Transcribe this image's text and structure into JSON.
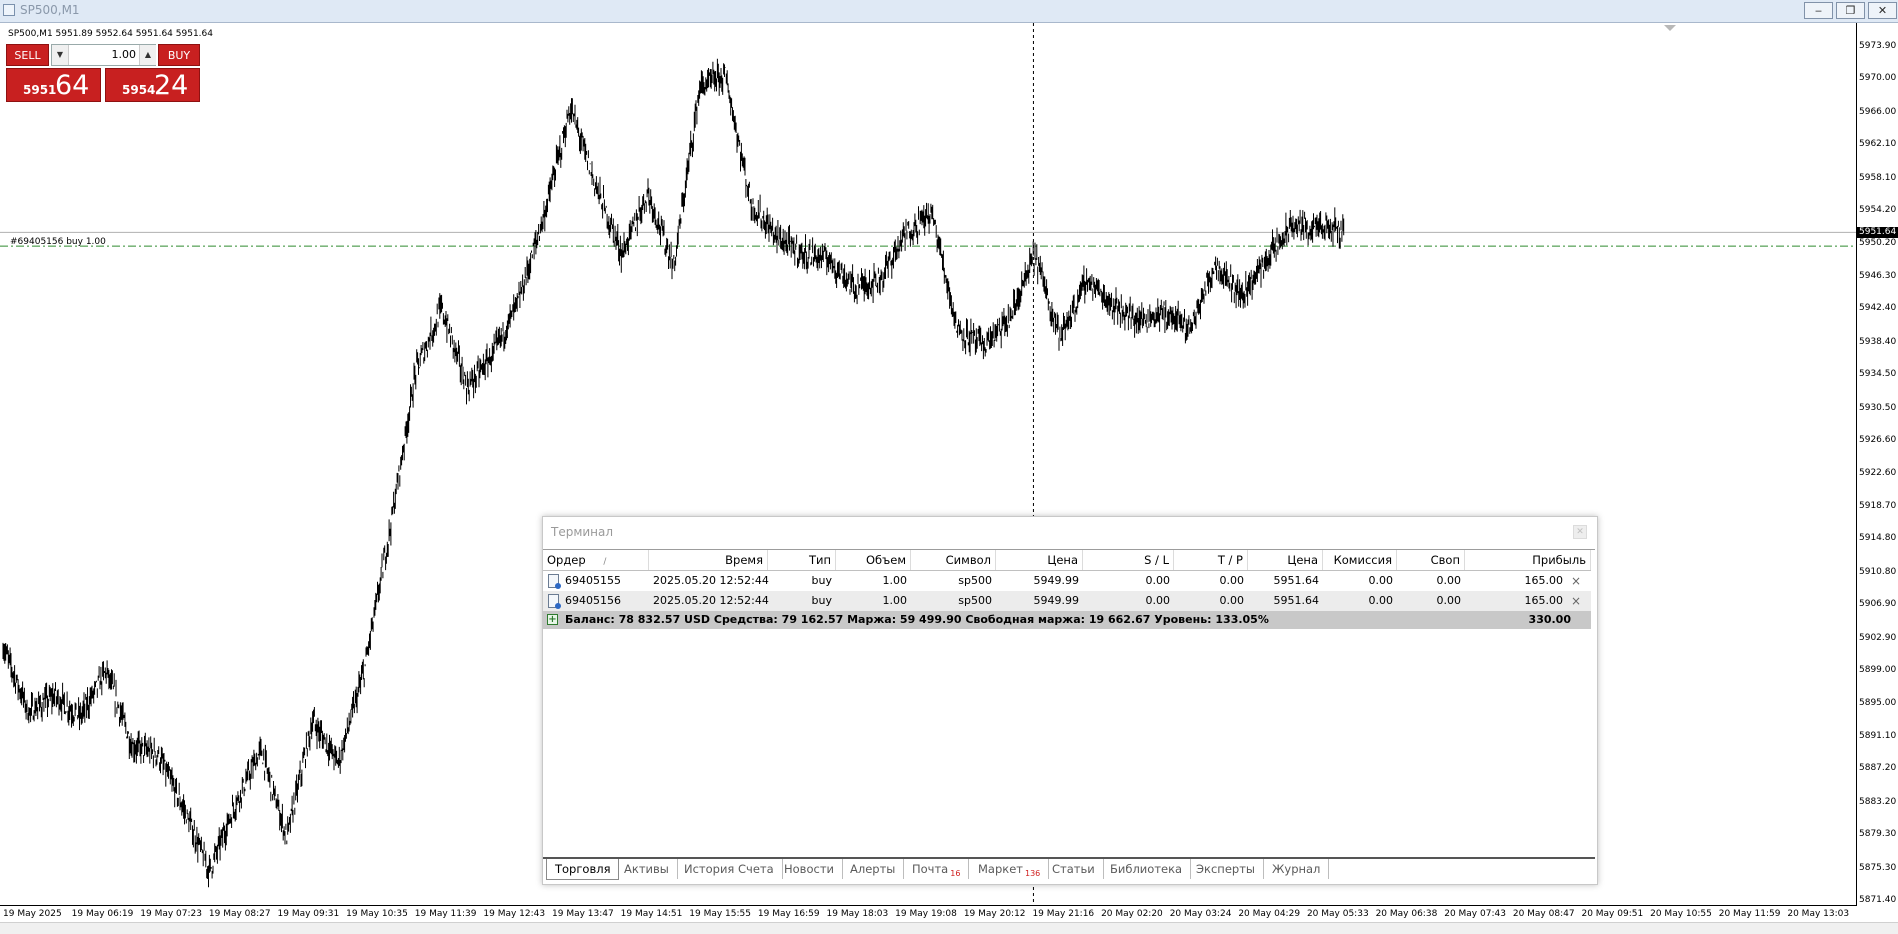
{
  "window": {
    "title": "SP500,M1",
    "controls": [
      "‒",
      "❐",
      "✕"
    ]
  },
  "chart": {
    "symbol_info": "SP500,M1  5951.89 5952.64 5951.64 5951.64",
    "order_line_label": "#69405156 buy 1.00",
    "current_price_tag": "5951.64",
    "colors": {
      "candles": "#000000",
      "order_line": "#2e8b2e",
      "bid_line": "#b0b0b0",
      "crosshair": "#000000"
    }
  },
  "one_click": {
    "sell_label": "SELL",
    "buy_label": "BUY",
    "lot": "1.00",
    "sell_price_small": "5951",
    "sell_price_big": "64",
    "buy_price_small": "5954",
    "buy_price_big": "24",
    "color": "#c82020"
  },
  "chart_data": {
    "type": "line",
    "title": "SP500,M1",
    "xlabel": "",
    "ylabel": "",
    "ylim": [
      5871.4,
      5975.8
    ],
    "y_ticks": [
      "5973.90",
      "5970.00",
      "5966.00",
      "5962.10",
      "5958.10",
      "5954.20",
      "5950.20",
      "5946.30",
      "5942.40",
      "5938.40",
      "5934.50",
      "5930.50",
      "5926.60",
      "5922.60",
      "5918.70",
      "5914.80",
      "5910.80",
      "5906.90",
      "5902.90",
      "5899.00",
      "5895.00",
      "5891.10",
      "5887.20",
      "5883.20",
      "5879.30",
      "5875.30",
      "5871.40"
    ],
    "x_ticks": [
      "19 May 2025",
      "19 May 06:19",
      "19 May 07:23",
      "19 May 08:27",
      "19 May 09:31",
      "19 May 10:35",
      "19 May 11:39",
      "19 May 12:43",
      "19 May 13:47",
      "19 May 14:51",
      "19 May 15:55",
      "19 May 16:59",
      "19 May 18:03",
      "19 May 19:08",
      "19 May 20:12",
      "19 May 21:16",
      "20 May 02:20",
      "20 May 03:24",
      "20 May 04:29",
      "20 May 05:33",
      "20 May 06:38",
      "20 May 07:43",
      "20 May 08:47",
      "20 May 09:51",
      "20 May 10:55",
      "20 May 11:59",
      "20 May 13:03"
    ],
    "series": [
      {
        "x": [
          0,
          0.5,
          1,
          1.5,
          2,
          2.5,
          3,
          3.5,
          4,
          4.5,
          5,
          5.5,
          6,
          6.5,
          7,
          7.5,
          8,
          8.5,
          9,
          9.5,
          10,
          10.5,
          11,
          11.5,
          12,
          12.5,
          13,
          13.5,
          14,
          14.5,
          15,
          15.5,
          16,
          16.5,
          17,
          17.5,
          18,
          18.5,
          19,
          19.5,
          20,
          20.5,
          21,
          21.5,
          22,
          22.5,
          23,
          23.5,
          24,
          24.5,
          25,
          25.5,
          26
        ],
        "y": [
          5902.0,
          5894.0,
          5896.0,
          5893.5,
          5899.0,
          5890.0,
          5889.0,
          5882.5,
          5875.0,
          5883.0,
          5889.5,
          5879.0,
          5893.0,
          5888.0,
          5899.0,
          5916.0,
          5935.0,
          5942.5,
          5933.0,
          5937.0,
          5943.5,
          5954.0,
          5966.5,
          5957.0,
          5949.0,
          5956.5,
          5947.5,
          5969.0,
          5970.5,
          5955.0,
          5951.0,
          5949.0,
          5948.5,
          5945.0,
          5946.0,
          5951.5,
          5954.0,
          5940.0,
          5938.0,
          5941.0,
          5949.0,
          5939.0,
          5946.0,
          5943.0,
          5941.0,
          5942.0,
          5940.0,
          5948.0,
          5944.0,
          5948.5,
          5952.5,
          5952.0,
          5952.0
        ]
      }
    ],
    "reference_lines": {
      "order_price": 5949.99,
      "bid_price": 5951.64,
      "crosshair_time": "19 May 21:16"
    },
    "grid": false,
    "legend": "none"
  },
  "terminal": {
    "title": "Терминал",
    "columns": [
      "Ордер",
      "Время",
      "Тип",
      "Объем",
      "Символ",
      "Цена",
      "S / L",
      "T / P",
      "Цена",
      "Комиссия",
      "Своп",
      "Прибыль"
    ],
    "sort_indicator": "/",
    "rows": [
      {
        "order": "69405155",
        "time": "2025.05.20 12:52:44",
        "type": "buy",
        "volume": "1.00",
        "symbol": "sp500",
        "price": "5949.99",
        "sl": "0.00",
        "tp": "0.00",
        "cur_price": "5951.64",
        "commission": "0.00",
        "swap": "0.00",
        "profit": "165.00"
      },
      {
        "order": "69405156",
        "time": "2025.05.20 12:52:44",
        "type": "buy",
        "volume": "1.00",
        "symbol": "sp500",
        "price": "5949.99",
        "sl": "0.00",
        "tp": "0.00",
        "cur_price": "5951.64",
        "commission": "0.00",
        "swap": "0.00",
        "profit": "165.00"
      }
    ],
    "summary": {
      "text": "Баланс: 78 832.57 USD  Средства: 79 162.57  Маржа: 59 499.90  Свободная маржа: 19 662.67  Уровень: 133.05%",
      "profit": "330.00"
    },
    "tabs": [
      {
        "label": "Торговля",
        "badge": ""
      },
      {
        "label": "Активы",
        "badge": ""
      },
      {
        "label": "История Счета",
        "badge": ""
      },
      {
        "label": "Новости",
        "badge": ""
      },
      {
        "label": "Алерты",
        "badge": ""
      },
      {
        "label": "Почта",
        "badge": "16"
      },
      {
        "label": "Маркет",
        "badge": "136"
      },
      {
        "label": "Статьи",
        "badge": ""
      },
      {
        "label": "Библиотека",
        "badge": ""
      },
      {
        "label": "Эксперты",
        "badge": ""
      },
      {
        "label": "Журнал",
        "badge": ""
      }
    ]
  }
}
